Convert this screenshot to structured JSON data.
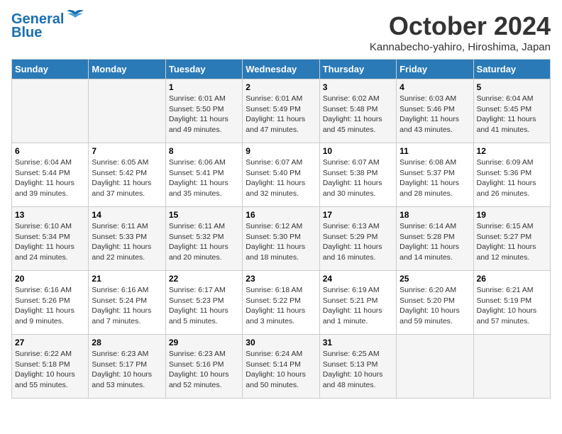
{
  "logo": {
    "line1": "General",
    "line2": "Blue"
  },
  "title": "October 2024",
  "location": "Kannabecho-yahiro, Hiroshima, Japan",
  "days_header": [
    "Sunday",
    "Monday",
    "Tuesday",
    "Wednesday",
    "Thursday",
    "Friday",
    "Saturday"
  ],
  "weeks": [
    [
      {
        "num": "",
        "info": ""
      },
      {
        "num": "",
        "info": ""
      },
      {
        "num": "1",
        "info": "Sunrise: 6:01 AM\nSunset: 5:50 PM\nDaylight: 11 hours and 49 minutes."
      },
      {
        "num": "2",
        "info": "Sunrise: 6:01 AM\nSunset: 5:49 PM\nDaylight: 11 hours and 47 minutes."
      },
      {
        "num": "3",
        "info": "Sunrise: 6:02 AM\nSunset: 5:48 PM\nDaylight: 11 hours and 45 minutes."
      },
      {
        "num": "4",
        "info": "Sunrise: 6:03 AM\nSunset: 5:46 PM\nDaylight: 11 hours and 43 minutes."
      },
      {
        "num": "5",
        "info": "Sunrise: 6:04 AM\nSunset: 5:45 PM\nDaylight: 11 hours and 41 minutes."
      }
    ],
    [
      {
        "num": "6",
        "info": "Sunrise: 6:04 AM\nSunset: 5:44 PM\nDaylight: 11 hours and 39 minutes."
      },
      {
        "num": "7",
        "info": "Sunrise: 6:05 AM\nSunset: 5:42 PM\nDaylight: 11 hours and 37 minutes."
      },
      {
        "num": "8",
        "info": "Sunrise: 6:06 AM\nSunset: 5:41 PM\nDaylight: 11 hours and 35 minutes."
      },
      {
        "num": "9",
        "info": "Sunrise: 6:07 AM\nSunset: 5:40 PM\nDaylight: 11 hours and 32 minutes."
      },
      {
        "num": "10",
        "info": "Sunrise: 6:07 AM\nSunset: 5:38 PM\nDaylight: 11 hours and 30 minutes."
      },
      {
        "num": "11",
        "info": "Sunrise: 6:08 AM\nSunset: 5:37 PM\nDaylight: 11 hours and 28 minutes."
      },
      {
        "num": "12",
        "info": "Sunrise: 6:09 AM\nSunset: 5:36 PM\nDaylight: 11 hours and 26 minutes."
      }
    ],
    [
      {
        "num": "13",
        "info": "Sunrise: 6:10 AM\nSunset: 5:34 PM\nDaylight: 11 hours and 24 minutes."
      },
      {
        "num": "14",
        "info": "Sunrise: 6:11 AM\nSunset: 5:33 PM\nDaylight: 11 hours and 22 minutes."
      },
      {
        "num": "15",
        "info": "Sunrise: 6:11 AM\nSunset: 5:32 PM\nDaylight: 11 hours and 20 minutes."
      },
      {
        "num": "16",
        "info": "Sunrise: 6:12 AM\nSunset: 5:30 PM\nDaylight: 11 hours and 18 minutes."
      },
      {
        "num": "17",
        "info": "Sunrise: 6:13 AM\nSunset: 5:29 PM\nDaylight: 11 hours and 16 minutes."
      },
      {
        "num": "18",
        "info": "Sunrise: 6:14 AM\nSunset: 5:28 PM\nDaylight: 11 hours and 14 minutes."
      },
      {
        "num": "19",
        "info": "Sunrise: 6:15 AM\nSunset: 5:27 PM\nDaylight: 11 hours and 12 minutes."
      }
    ],
    [
      {
        "num": "20",
        "info": "Sunrise: 6:16 AM\nSunset: 5:26 PM\nDaylight: 11 hours and 9 minutes."
      },
      {
        "num": "21",
        "info": "Sunrise: 6:16 AM\nSunset: 5:24 PM\nDaylight: 11 hours and 7 minutes."
      },
      {
        "num": "22",
        "info": "Sunrise: 6:17 AM\nSunset: 5:23 PM\nDaylight: 11 hours and 5 minutes."
      },
      {
        "num": "23",
        "info": "Sunrise: 6:18 AM\nSunset: 5:22 PM\nDaylight: 11 hours and 3 minutes."
      },
      {
        "num": "24",
        "info": "Sunrise: 6:19 AM\nSunset: 5:21 PM\nDaylight: 11 hours and 1 minute."
      },
      {
        "num": "25",
        "info": "Sunrise: 6:20 AM\nSunset: 5:20 PM\nDaylight: 10 hours and 59 minutes."
      },
      {
        "num": "26",
        "info": "Sunrise: 6:21 AM\nSunset: 5:19 PM\nDaylight: 10 hours and 57 minutes."
      }
    ],
    [
      {
        "num": "27",
        "info": "Sunrise: 6:22 AM\nSunset: 5:18 PM\nDaylight: 10 hours and 55 minutes."
      },
      {
        "num": "28",
        "info": "Sunrise: 6:23 AM\nSunset: 5:17 PM\nDaylight: 10 hours and 53 minutes."
      },
      {
        "num": "29",
        "info": "Sunrise: 6:23 AM\nSunset: 5:16 PM\nDaylight: 10 hours and 52 minutes."
      },
      {
        "num": "30",
        "info": "Sunrise: 6:24 AM\nSunset: 5:14 PM\nDaylight: 10 hours and 50 minutes."
      },
      {
        "num": "31",
        "info": "Sunrise: 6:25 AM\nSunset: 5:13 PM\nDaylight: 10 hours and 48 minutes."
      },
      {
        "num": "",
        "info": ""
      },
      {
        "num": "",
        "info": ""
      }
    ]
  ]
}
